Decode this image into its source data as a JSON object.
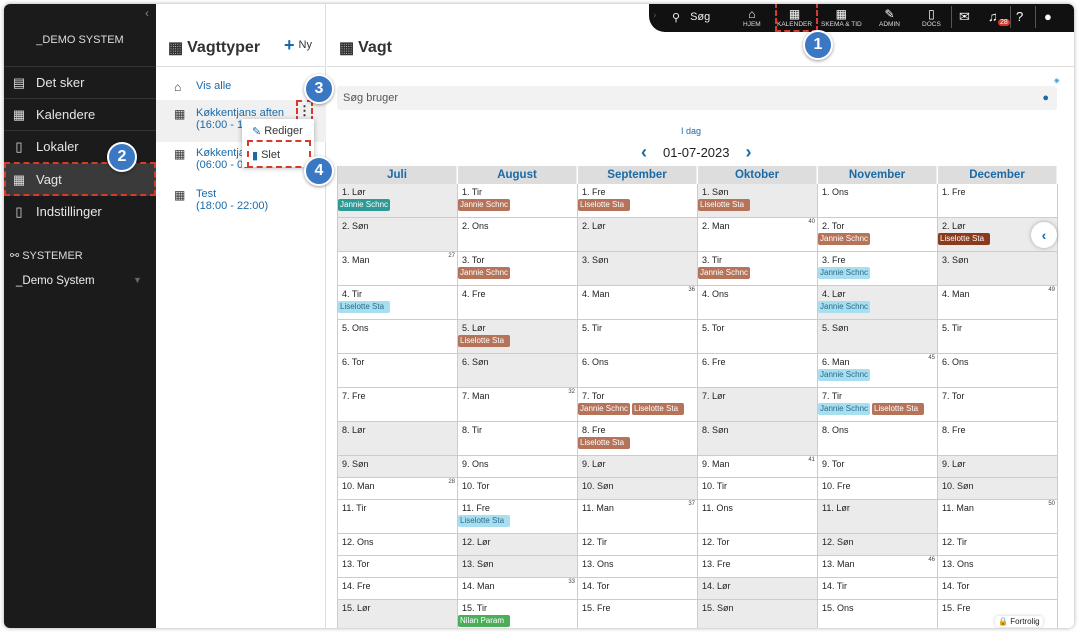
{
  "sidebar": {
    "brand": "_DEMO SYSTEM",
    "items": [
      {
        "label": "Det sker"
      },
      {
        "label": "Kalendere"
      },
      {
        "label": "Lokaler"
      },
      {
        "label": "Vagt"
      },
      {
        "label": "Indstillinger"
      }
    ],
    "systems_heading": "SYSTEMER",
    "system_name": "_Demo System"
  },
  "middle": {
    "title": "Vagttyper",
    "new_label": "Ny",
    "show_all": "Vis alle",
    "shifts": [
      {
        "name": "Køkkentjans aften",
        "time": "(16:00 - 18"
      },
      {
        "name": "Køkkentja",
        "time": "(06:00 - 09"
      },
      {
        "name": "Test",
        "time": "(18:00 - 22:00)"
      }
    ],
    "menu": {
      "edit": "Rediger",
      "delete": "Slet"
    }
  },
  "topbar": {
    "search": "Søg",
    "items": [
      {
        "label": "HJEM"
      },
      {
        "label": "KALENDER"
      },
      {
        "label": "SKEMA & TID"
      },
      {
        "label": "ADMIN"
      },
      {
        "label": "DOCS"
      }
    ],
    "bell_count": "28"
  },
  "main": {
    "title": "Vagt",
    "search_placeholder": "Søg bruger",
    "today": "I dag",
    "date": "01-07-2023",
    "fortrolig": "Fortrolig"
  },
  "badges": [
    "1",
    "2",
    "3",
    "4"
  ],
  "colors": {
    "accent": "#1a6aa8",
    "teal": "#2e9a96",
    "brown": "#b5735a",
    "lightblue": "#a8dff0",
    "darkred": "#8b3a1e",
    "green": "#4cae5a",
    "annotation": "#d63a2a"
  },
  "calendar": {
    "months": [
      "Juli",
      "August",
      "September",
      "Oktober",
      "November",
      "December"
    ],
    "rows": [
      [
        {
          "d": "1. Lør",
          "we": 1,
          "t": [
            [
              "Jannie Schnc",
              "teal"
            ]
          ]
        },
        {
          "d": "1. Tir",
          "t": [
            [
              "Jannie Schnc",
              "brown"
            ]
          ]
        },
        {
          "d": "1. Fre",
          "t": [
            [
              "Liselotte Sta",
              "brown"
            ]
          ]
        },
        {
          "d": "1. Søn",
          "we": 1,
          "t": [
            [
              "Liselotte Sta",
              "brown"
            ]
          ]
        },
        {
          "d": "1. Ons"
        },
        {
          "d": "1. Fre"
        }
      ],
      [
        {
          "d": "2. Søn",
          "we": 1
        },
        {
          "d": "2. Ons"
        },
        {
          "d": "2. Lør",
          "we": 1
        },
        {
          "d": "2. Man",
          "wk": "40"
        },
        {
          "d": "2. Tor",
          "t": [
            [
              "Jannie Schnc",
              "brown"
            ]
          ]
        },
        {
          "d": "2. Lør",
          "we": 1,
          "t": [
            [
              "Liselotte Sta",
              "darkred"
            ]
          ]
        }
      ],
      [
        {
          "d": "3. Man",
          "wk": "27"
        },
        {
          "d": "3. Tor",
          "t": [
            [
              "Jannie Schnc",
              "brown"
            ]
          ]
        },
        {
          "d": "3. Søn",
          "we": 1
        },
        {
          "d": "3. Tir",
          "t": [
            [
              "Jannie Schnc",
              "brown"
            ]
          ]
        },
        {
          "d": "3. Fre",
          "t": [
            [
              "Jannie Schnc",
              "lightblue"
            ]
          ]
        },
        {
          "d": "3. Søn",
          "we": 1
        }
      ],
      [
        {
          "d": "4. Tir",
          "t": [
            [
              "Liselotte Sta",
              "lightblue"
            ]
          ]
        },
        {
          "d": "4. Fre"
        },
        {
          "d": "4. Man",
          "wk": "36"
        },
        {
          "d": "4. Ons"
        },
        {
          "d": "4. Lør",
          "we": 1,
          "t": [
            [
              "Jannie Schnc",
              "lightblue"
            ]
          ]
        },
        {
          "d": "4. Man",
          "wk": "49"
        }
      ],
      [
        {
          "d": "5. Ons"
        },
        {
          "d": "5. Lør",
          "we": 1,
          "t": [
            [
              "Liselotte Sta",
              "brown"
            ]
          ]
        },
        {
          "d": "5. Tir"
        },
        {
          "d": "5. Tor"
        },
        {
          "d": "5. Søn",
          "we": 1
        },
        {
          "d": "5. Tir"
        }
      ],
      [
        {
          "d": "6. Tor"
        },
        {
          "d": "6. Søn",
          "we": 1
        },
        {
          "d": "6. Ons"
        },
        {
          "d": "6. Fre"
        },
        {
          "d": "6. Man",
          "wk": "45",
          "t": [
            [
              "Jannie Schnc",
              "lightblue"
            ]
          ]
        },
        {
          "d": "6. Ons"
        }
      ],
      [
        {
          "d": "7. Fre"
        },
        {
          "d": "7. Man",
          "wk": "32"
        },
        {
          "d": "7. Tor",
          "t": [
            [
              "Jannie Schnc",
              "brown"
            ],
            [
              "Liselotte Sta",
              "brown"
            ]
          ]
        },
        {
          "d": "7. Lør",
          "we": 1
        },
        {
          "d": "7. Tir",
          "t": [
            [
              "Jannie Schnc",
              "lightblue"
            ],
            [
              "Liselotte Sta",
              "brown"
            ]
          ]
        },
        {
          "d": "7. Tor"
        }
      ],
      [
        {
          "d": "8. Lør",
          "we": 1
        },
        {
          "d": "8. Tir"
        },
        {
          "d": "8. Fre",
          "t": [
            [
              "Liselotte Sta",
              "brown"
            ]
          ]
        },
        {
          "d": "8. Søn",
          "we": 1
        },
        {
          "d": "8. Ons"
        },
        {
          "d": "8. Fre"
        }
      ],
      [
        {
          "d": "9. Søn",
          "we": 1
        },
        {
          "d": "9. Ons"
        },
        {
          "d": "9. Lør",
          "we": 1
        },
        {
          "d": "9. Man",
          "wk": "41"
        },
        {
          "d": "9. Tor"
        },
        {
          "d": "9. Lør",
          "we": 1
        }
      ],
      [
        {
          "d": "10. Man",
          "wk": "28"
        },
        {
          "d": "10. Tor"
        },
        {
          "d": "10. Søn",
          "we": 1
        },
        {
          "d": "10. Tir"
        },
        {
          "d": "10. Fre"
        },
        {
          "d": "10. Søn",
          "we": 1
        }
      ],
      [
        {
          "d": "11. Tir"
        },
        {
          "d": "11. Fre",
          "t": [
            [
              "Liselotte Sta",
              "lightblue"
            ]
          ]
        },
        {
          "d": "11. Man",
          "wk": "37"
        },
        {
          "d": "11. Ons"
        },
        {
          "d": "11. Lør",
          "we": 1
        },
        {
          "d": "11. Man",
          "wk": "50"
        }
      ],
      [
        {
          "d": "12. Ons"
        },
        {
          "d": "12. Lør",
          "we": 1
        },
        {
          "d": "12. Tir"
        },
        {
          "d": "12. Tor"
        },
        {
          "d": "12. Søn",
          "we": 1
        },
        {
          "d": "12. Tir"
        }
      ],
      [
        {
          "d": "13. Tor"
        },
        {
          "d": "13. Søn",
          "we": 1
        },
        {
          "d": "13. Ons"
        },
        {
          "d": "13. Fre"
        },
        {
          "d": "13. Man",
          "wk": "46"
        },
        {
          "d": "13. Ons"
        }
      ],
      [
        {
          "d": "14. Fre"
        },
        {
          "d": "14. Man",
          "wk": "33"
        },
        {
          "d": "14. Tor"
        },
        {
          "d": "14. Lør",
          "we": 1
        },
        {
          "d": "14. Tir"
        },
        {
          "d": "14. Tor"
        }
      ],
      [
        {
          "d": "15. Lør",
          "we": 1
        },
        {
          "d": "15. Tir",
          "t": [
            [
              "Nilan Param",
              "green"
            ]
          ]
        },
        {
          "d": "15. Fre"
        },
        {
          "d": "15. Søn",
          "we": 1
        },
        {
          "d": "15. Ons"
        },
        {
          "d": "15. Fre"
        }
      ]
    ]
  }
}
